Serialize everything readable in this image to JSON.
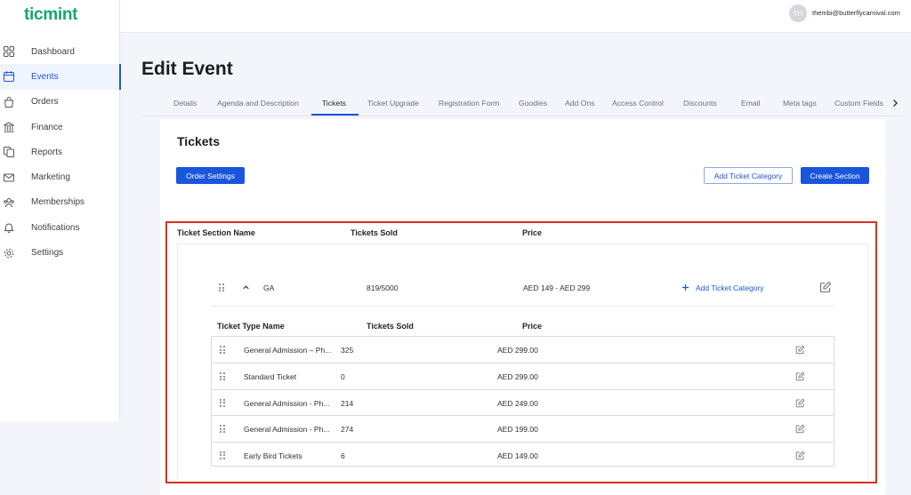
{
  "app": {
    "logo": "ticmint"
  },
  "sidebar": {
    "items": [
      {
        "label": "Dashboard",
        "icon": "grid-icon"
      },
      {
        "label": "Events",
        "icon": "calendar-icon"
      },
      {
        "label": "Orders",
        "icon": "bag-icon"
      },
      {
        "label": "Finance",
        "icon": "bank-icon"
      },
      {
        "label": "Reports",
        "icon": "document-copy-icon"
      },
      {
        "label": "Marketing",
        "icon": "mail-icon"
      },
      {
        "label": "Memberships",
        "icon": "users-icon"
      },
      {
        "label": "Notifications",
        "icon": "bell-icon"
      },
      {
        "label": "Settings",
        "icon": "gear-icon"
      }
    ],
    "active_index": 1
  },
  "topbar": {
    "avatar_initials": "TH",
    "user_email": "thembi@butterflycarnival.com"
  },
  "page": {
    "title": "Edit Event"
  },
  "tabs": [
    "Details",
    "Agenda and Description",
    "Tickets",
    "Ticket Upgrade",
    "Registration Form",
    "Goodies",
    "Add Ons",
    "Access Control",
    "Discounts",
    "Email",
    "Meta tags",
    "Custom Fields"
  ],
  "active_tab": "Tickets",
  "tickets": {
    "title": "Tickets",
    "order_settings_label": "Order Settings",
    "add_category_label": "Add Ticket Category",
    "create_section_label": "Create Section",
    "section_headers": {
      "name": "Ticket Section Name",
      "sold": "Tickets Sold",
      "price": "Price"
    },
    "section": {
      "name": "GA",
      "sold": "819/5000",
      "price": "AED 149 - AED 299",
      "add_category_label": "Add Ticket Category"
    },
    "type_headers": {
      "name": "Ticket Type Name",
      "sold": "Tickets Sold",
      "price": "Price"
    },
    "types": [
      {
        "name": "General Admission – Ph...",
        "sold": "325",
        "price": "AED 299.00"
      },
      {
        "name": "Standard Ticket",
        "sold": "0",
        "price": "AED 299.00"
      },
      {
        "name": "General Admission - Ph...",
        "sold": "214",
        "price": "AED 249.00"
      },
      {
        "name": "General Admission - Ph...",
        "sold": "274",
        "price": "AED 199.00"
      },
      {
        "name": "Early Bird Tickets",
        "sold": "6",
        "price": "AED 149.00"
      }
    ]
  },
  "colors": {
    "brand": "#17a673",
    "primary": "#1a56db",
    "highlight": "#d6311f"
  }
}
